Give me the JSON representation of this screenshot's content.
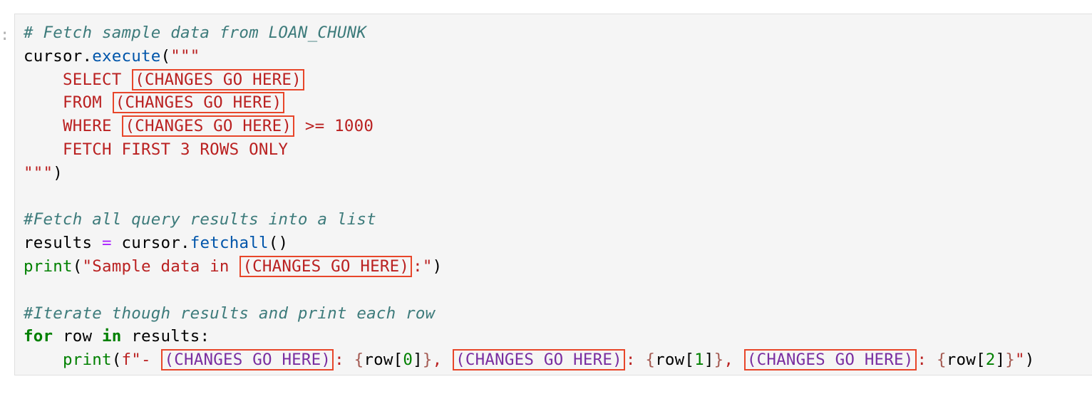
{
  "cell": {
    "prompt": ":",
    "placeholder": "(CHANGES GO HERE)",
    "lines": {
      "l1": "# Fetch sample data from LOAN_CHUNK",
      "l2_a": "cursor",
      "l2_b": ".",
      "l2_c": "execute",
      "l2_d": "(",
      "l2_e": "\"\"\"",
      "l3_a": "    SELECT ",
      "l4_a": "    FROM ",
      "l5_a": "    WHERE ",
      "l5_b": " >= 1000",
      "l6": "    FETCH FIRST 3 ROWS ONLY",
      "l7_a": "\"\"\"",
      "l7_b": ")",
      "l9": "#Fetch all query results into a list",
      "l10_a": "results ",
      "l10_b": "=",
      "l10_c": " cursor",
      "l10_d": ".",
      "l10_e": "fetchall",
      "l10_f": "()",
      "l11_a": "print",
      "l11_b": "(",
      "l11_c": "\"Sample data in ",
      "l11_d": ":\"",
      "l11_e": ")",
      "l13": "#Iterate though results and print each row",
      "l14_a": "for",
      "l14_b": " row ",
      "l14_c": "in",
      "l14_d": " results:",
      "l15_a": "    ",
      "l15_b": "print",
      "l15_c": "(",
      "l15_d": "f\"- ",
      "l15_e": ": ",
      "l15_f": "{",
      "l15_g": "row[",
      "l15_h": "0",
      "l15_i": "]",
      "l15_j": "}",
      "l15_k": ", ",
      "l15_l": ": ",
      "l15_m": "{",
      "l15_n": "row[",
      "l15_o": "1",
      "l15_p": "]",
      "l15_q": "}",
      "l15_r": ", ",
      "l15_s": ": ",
      "l15_t": "{",
      "l15_u": "row[",
      "l15_v": "2",
      "l15_w": "]",
      "l15_x": "}",
      "l15_y": "\"",
      "l15_z": ")"
    }
  }
}
